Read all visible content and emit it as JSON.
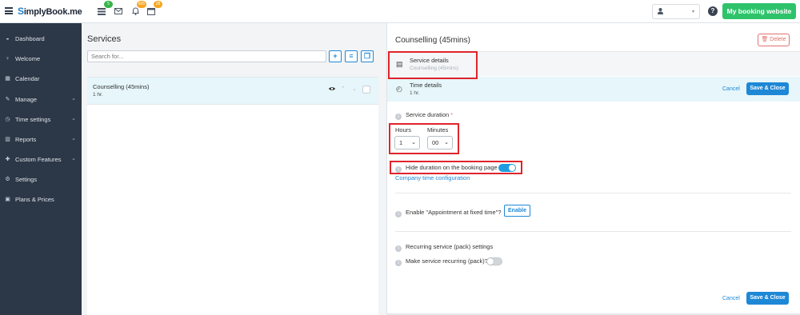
{
  "topbar": {
    "logo_s": "S",
    "logo_text": "implyBook",
    "logo_suffix": ".me",
    "badge_list": "5",
    "badge_bell": "695",
    "badge_calendar": "28",
    "user_dd_arrow": "▾",
    "help": "?",
    "booking_btn": "My booking website"
  },
  "sidebar": {
    "items": [
      {
        "label": "Dashboard",
        "icon": "dashboard-icon",
        "glyph": "◒"
      },
      {
        "label": "Welcome",
        "icon": "lightbulb-icon",
        "glyph": "♀"
      },
      {
        "label": "Calendar",
        "icon": "calendar-icon",
        "glyph": "▦"
      },
      {
        "label": "Manage",
        "icon": "pencil-icon",
        "glyph": "✎",
        "chevron": "⌄"
      },
      {
        "label": "Time settings",
        "icon": "clock-icon",
        "glyph": "◷",
        "chevron": "⌄"
      },
      {
        "label": "Reports",
        "icon": "bar-chart-icon",
        "glyph": "▥",
        "chevron": "⌄"
      },
      {
        "label": "Custom Features",
        "icon": "puzzle-icon",
        "glyph": "✚",
        "chevron": "⌄"
      },
      {
        "label": "Settings",
        "icon": "cogs-icon",
        "glyph": "⚙"
      },
      {
        "label": "Plans & Prices",
        "icon": "money-icon",
        "glyph": "▣"
      }
    ]
  },
  "services": {
    "title": "Services",
    "search_placeholder": "Search for...",
    "add_btn": "+",
    "list_btn": "≡",
    "copy_btn": "❐",
    "rows": [
      {
        "name": "Counselling (45mins)",
        "duration": "1 hr."
      }
    ],
    "eye": "👁",
    "up": "⌃",
    "down": "⌄"
  },
  "details": {
    "title": "Counselling (45mins)",
    "delete_label": "🗑 Delete",
    "service_details_label": "Service details",
    "service_details_sub": "Counselling (45mins)",
    "time_details_label": "Time details",
    "time_details_sub": "1 hr.",
    "cancel_label": "Cancel",
    "save_close_label": "Save & Close",
    "service_duration_label": "Service duration",
    "required_mark": "*",
    "hours_label": "Hours",
    "minutes_label": "Minutes",
    "hours_value": "1",
    "minutes_value": "00",
    "select_arrow": "⌄",
    "hide_duration_label": "Hide duration on the booking page",
    "hide_duration_on": true,
    "company_time_link": "Company time configuration",
    "fixed_time_label": "Enable \"Appointment at fixed time\"?",
    "enable_btn": "Enable",
    "recurring_settings_label": "Recurring service (pack) settings",
    "recurring_label": "Make service recurring (pack)?",
    "recurring_on": false,
    "info_glyph": "i",
    "doc_glyph": "▤",
    "clock_glyph": "◴"
  },
  "colors": {
    "accent": "#1e88d6",
    "brand_green": "#2ec36b",
    "sidebar_bg": "#2c3747",
    "highlight_box": "#e0242b"
  }
}
